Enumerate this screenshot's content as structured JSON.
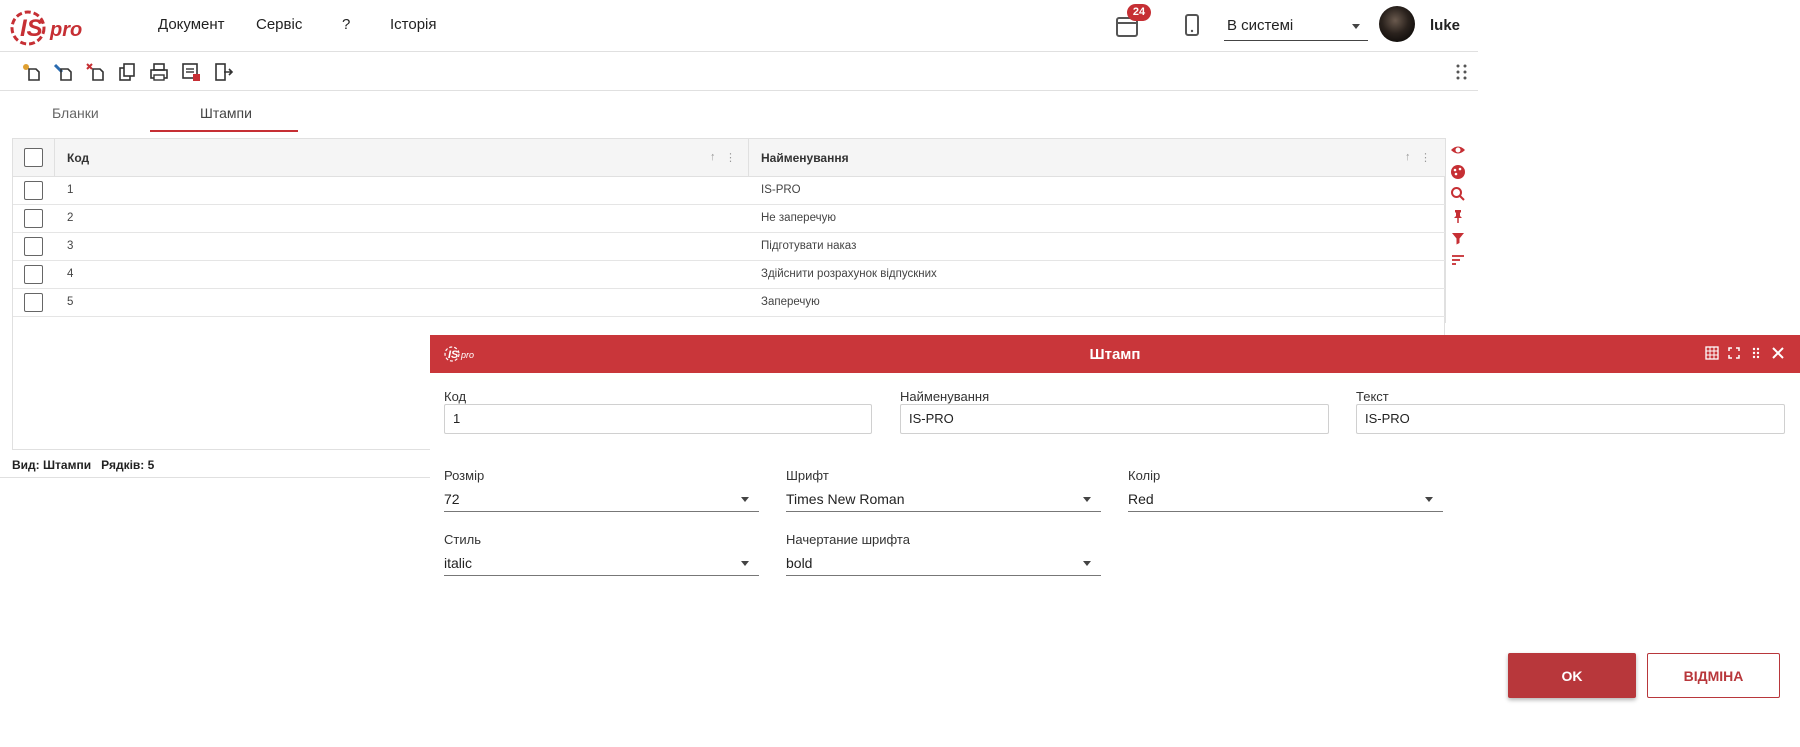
{
  "header": {
    "logo_text": "ISpro",
    "menu": [
      "Документ",
      "Сервіс",
      "?",
      "Історія"
    ],
    "notifications_count": "24",
    "status_select": "В системі",
    "username": "luke"
  },
  "toolbar": {
    "icons": [
      "add-record-icon",
      "edit-record-icon",
      "delete-record-icon",
      "copy-record-icon",
      "print-icon",
      "preview-icon",
      "exit-icon"
    ]
  },
  "tabs": [
    {
      "label": "Бланки",
      "active": false
    },
    {
      "label": "Штампи",
      "active": true
    }
  ],
  "grid": {
    "columns": [
      "Код",
      "Найменування"
    ],
    "rows": [
      {
        "code": "1",
        "name": "IS-PRO"
      },
      {
        "code": "2",
        "name": "Не заперечую"
      },
      {
        "code": "3",
        "name": "Підготувати наказ"
      },
      {
        "code": "4",
        "name": "Здійснити розрахунок відпускних"
      },
      {
        "code": "5",
        "name": "Заперечую"
      }
    ],
    "status": "Вид: Штампи   Рядків: 5"
  },
  "side_icons": [
    "eye-icon",
    "palette-icon",
    "search-icon",
    "pin-icon",
    "filter-icon",
    "sort-icon"
  ],
  "dialog": {
    "title": "Штамп",
    "logo_text": "ISpro",
    "fields": {
      "code": {
        "label": "Код",
        "value": "1"
      },
      "name": {
        "label": "Найменування",
        "value": "IS-PRO"
      },
      "text": {
        "label": "Текст",
        "value": "IS-PRO"
      },
      "size": {
        "label": "Розмір",
        "value": "72"
      },
      "font": {
        "label": "Шрифт",
        "value": "Times New Roman"
      },
      "color": {
        "label": "Колір",
        "value": "Red"
      },
      "style": {
        "label": "Стиль",
        "value": "italic"
      },
      "weight": {
        "label": "Начертание шрифта",
        "value": "bold"
      }
    },
    "ok_label": "OK",
    "cancel_label": "ВІДМІНА"
  },
  "colors": {
    "brand_red": "#c9363a",
    "button_red": "#b8373b"
  }
}
